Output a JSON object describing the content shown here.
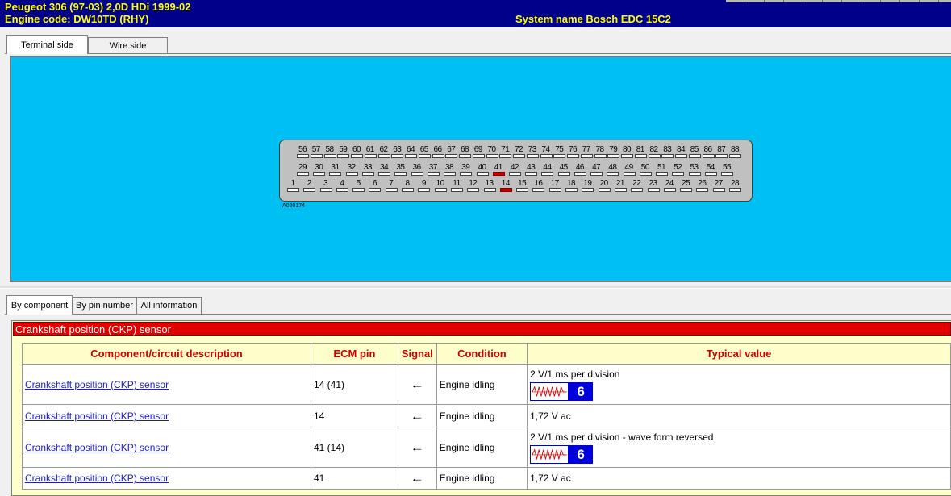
{
  "header": {
    "vehicle": "Peugeot   306 (97-03) 2,0D HDi 1999-02",
    "engine_code": "Engine code: DW10TD (RHY)",
    "system_name": "System name Bosch EDC 15C2"
  },
  "view_tabs": [
    "Terminal side",
    "Wire side"
  ],
  "connector": {
    "code": "A020174",
    "row_top": [
      "56",
      "57",
      "58",
      "59",
      "60",
      "61",
      "62",
      "63",
      "64",
      "65",
      "66",
      "67",
      "68",
      "69",
      "70",
      "71",
      "72",
      "73",
      "74",
      "75",
      "76",
      "77",
      "78",
      "79",
      "80",
      "81",
      "82",
      "83",
      "84",
      "85",
      "86",
      "87",
      "88"
    ],
    "row_mid": [
      "29",
      "30",
      "31",
      "32",
      "33",
      "34",
      "35",
      "36",
      "37",
      "38",
      "39",
      "40",
      "41",
      "42",
      "43",
      "44",
      "45",
      "46",
      "47",
      "48",
      "49",
      "50",
      "51",
      "52",
      "53",
      "54",
      "55"
    ],
    "row_bot": [
      "1",
      "2",
      "3",
      "4",
      "5",
      "6",
      "7",
      "8",
      "9",
      "10",
      "11",
      "12",
      "13",
      "14",
      "15",
      "16",
      "17",
      "18",
      "19",
      "20",
      "21",
      "22",
      "23",
      "24",
      "25",
      "26",
      "27",
      "28"
    ],
    "highlighted_pins": [
      "14",
      "41"
    ],
    "highlight_color": "#cc0000",
    "background_color": "#00bff3"
  },
  "info_tabs": [
    "By component",
    "By pin number",
    "All information"
  ],
  "section": {
    "title": "Crankshaft position (CKP) sensor",
    "headers": {
      "description": "Component/circuit description",
      "ecm_pin": "ECM pin",
      "signal": "Signal",
      "condition": "Condition",
      "typical_value": "Typical value"
    },
    "rows": [
      {
        "description": "Crankshaft position (CKP) sensor",
        "ecm_pin": "14 (41)",
        "signal": "←",
        "condition": "Engine idling",
        "typical_value": "2 V/1 ms per division",
        "waveform_number": "6"
      },
      {
        "description": "Crankshaft position (CKP) sensor",
        "ecm_pin": "14",
        "signal": "←",
        "condition": "Engine idling",
        "typical_value": "1,72 V ac"
      },
      {
        "description": "Crankshaft position (CKP) sensor",
        "ecm_pin": "41 (14)",
        "signal": "←",
        "condition": "Engine idling",
        "typical_value": "2 V/1 ms per division - wave form reversed",
        "waveform_number": "6"
      },
      {
        "description": "Crankshaft position (CKP) sensor",
        "ecm_pin": "41",
        "signal": "←",
        "condition": "Engine idling",
        "typical_value": "1,72 V ac"
      }
    ]
  }
}
